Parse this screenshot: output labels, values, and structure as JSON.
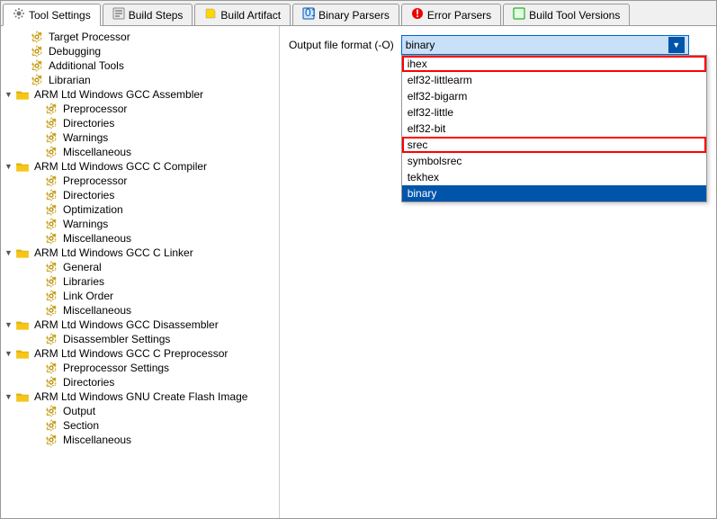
{
  "tabs": [
    {
      "id": "tool-settings",
      "label": "Tool Settings",
      "icon": "gear",
      "active": true
    },
    {
      "id": "build-steps",
      "label": "Build Steps",
      "icon": "steps",
      "active": false
    },
    {
      "id": "build-artifact",
      "label": "Build Artifact",
      "icon": "artifact",
      "active": false
    },
    {
      "id": "binary-parsers",
      "label": "Binary Parsers",
      "icon": "binary",
      "active": false
    },
    {
      "id": "error-parsers",
      "label": "Error Parsers",
      "icon": "error",
      "active": false
    },
    {
      "id": "build-tool-versions",
      "label": "Build Tool Versions",
      "icon": "versions",
      "active": false
    }
  ],
  "tree": [
    {
      "label": "Target Processor",
      "level": 1,
      "has_arrow": false,
      "icon": "gear"
    },
    {
      "label": "Debugging",
      "level": 1,
      "has_arrow": false,
      "icon": "gear"
    },
    {
      "label": "Additional Tools",
      "level": 1,
      "has_arrow": false,
      "icon": "gear"
    },
    {
      "label": "Librarian",
      "level": 1,
      "has_arrow": false,
      "icon": "gear"
    },
    {
      "label": "ARM Ltd Windows GCC Assembler",
      "level": 0,
      "has_arrow": true,
      "arrow_dir": "down",
      "icon": "folder"
    },
    {
      "label": "Preprocessor",
      "level": 2,
      "has_arrow": false,
      "icon": "gear"
    },
    {
      "label": "Directories",
      "level": 2,
      "has_arrow": false,
      "icon": "gear"
    },
    {
      "label": "Warnings",
      "level": 2,
      "has_arrow": false,
      "icon": "gear"
    },
    {
      "label": "Miscellaneous",
      "level": 2,
      "has_arrow": false,
      "icon": "gear"
    },
    {
      "label": "ARM Ltd Windows GCC C Compiler",
      "level": 0,
      "has_arrow": true,
      "arrow_dir": "down",
      "icon": "folder"
    },
    {
      "label": "Preprocessor",
      "level": 2,
      "has_arrow": false,
      "icon": "gear"
    },
    {
      "label": "Directories",
      "level": 2,
      "has_arrow": false,
      "icon": "gear"
    },
    {
      "label": "Optimization",
      "level": 2,
      "has_arrow": false,
      "icon": "gear"
    },
    {
      "label": "Warnings",
      "level": 2,
      "has_arrow": false,
      "icon": "gear"
    },
    {
      "label": "Miscellaneous",
      "level": 2,
      "has_arrow": false,
      "icon": "gear"
    },
    {
      "label": "ARM Ltd Windows GCC C Linker",
      "level": 0,
      "has_arrow": true,
      "arrow_dir": "down",
      "icon": "folder"
    },
    {
      "label": "General",
      "level": 2,
      "has_arrow": false,
      "icon": "gear"
    },
    {
      "label": "Libraries",
      "level": 2,
      "has_arrow": false,
      "icon": "gear"
    },
    {
      "label": "Link Order",
      "level": 2,
      "has_arrow": false,
      "icon": "gear"
    },
    {
      "label": "Miscellaneous",
      "level": 2,
      "has_arrow": false,
      "icon": "gear"
    },
    {
      "label": "ARM Ltd Windows GCC Disassembler",
      "level": 0,
      "has_arrow": true,
      "arrow_dir": "down",
      "icon": "folder"
    },
    {
      "label": "Disassembler Settings",
      "level": 2,
      "has_arrow": false,
      "icon": "gear"
    },
    {
      "label": "ARM Ltd Windows GCC C Preprocessor",
      "level": 0,
      "has_arrow": true,
      "arrow_dir": "down",
      "icon": "folder"
    },
    {
      "label": "Preprocessor Settings",
      "level": 2,
      "has_arrow": false,
      "icon": "gear"
    },
    {
      "label": "Directories",
      "level": 2,
      "has_arrow": false,
      "icon": "gear"
    },
    {
      "label": "ARM Ltd Windows GNU Create Flash Image",
      "level": 0,
      "has_arrow": true,
      "arrow_dir": "down",
      "icon": "folder"
    },
    {
      "label": "Output",
      "level": 2,
      "has_arrow": false,
      "icon": "gear"
    },
    {
      "label": "Section",
      "level": 2,
      "has_arrow": false,
      "icon": "gear"
    },
    {
      "label": "Miscellaneous",
      "level": 2,
      "has_arrow": false,
      "icon": "gear"
    }
  ],
  "settings": {
    "output_format_label": "Output file format (-O)",
    "output_format_value": "binary",
    "dropdown_options": [
      {
        "value": "ihex",
        "label": "ihex",
        "highlighted": true
      },
      {
        "value": "elf32-littlearm",
        "label": "elf32-littlearm"
      },
      {
        "value": "elf32-bigarm",
        "label": "elf32-bigarm"
      },
      {
        "value": "elf32-little",
        "label": "elf32-little"
      },
      {
        "value": "elf32-bit",
        "label": "elf32-bit"
      },
      {
        "value": "srec",
        "label": "srec",
        "highlighted": true
      },
      {
        "value": "symbolsrec",
        "label": "symbolsrec"
      },
      {
        "value": "tekhex",
        "label": "tekhex"
      },
      {
        "value": "binary",
        "label": "binary",
        "selected": true
      }
    ]
  }
}
